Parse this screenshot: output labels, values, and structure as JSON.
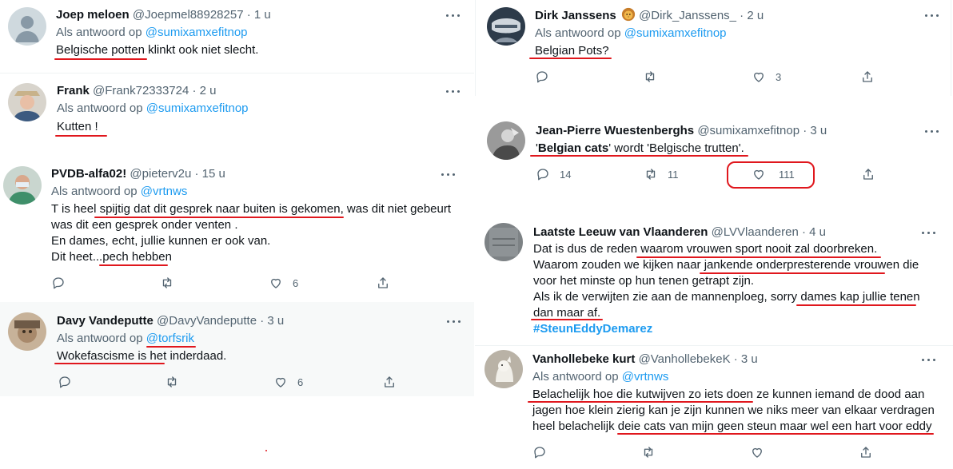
{
  "left": [
    {
      "name": "Joep meloen",
      "meta": "@Joepmel88928257 · 1 u",
      "reply_prefix": "Als antwoord op",
      "reply_to": "@sumixamxefitnop",
      "lines": [
        "Belgische potten klinkt ook niet slecht."
      ]
    },
    {
      "name": "Frank",
      "meta": "@Frank72333724 · 2 u",
      "reply_prefix": "Als antwoord op",
      "reply_to": "@sumixamxefitnop",
      "lines": [
        "Kutten !"
      ]
    },
    {
      "name": "PVDB-alfa02!",
      "meta": "@pieterv2u · 15 u",
      "reply_prefix": "Als antwoord op",
      "reply_to": "@vrtnws",
      "lines": [
        "T is heel spijtig dat dit gesprek naar buiten is gekomen, was dit niet gebeurt",
        "was dit een gesprek onder venten .",
        "En dames, echt, jullie kunnen er ook van.",
        "Dit heet...pech hebben"
      ],
      "likes": "6"
    },
    {
      "name": "Davy Vandeputte",
      "meta": "@DavyVandeputte · 3 u",
      "reply_prefix": "Als antwoord op",
      "reply_to": "@torfsrik",
      "lines": [
        "Wokefascisme is het inderdaad."
      ],
      "likes": "6"
    }
  ],
  "right": [
    {
      "name": "Dirk Janssens",
      "badge": "lion-emoji",
      "meta": "@Dirk_Janssens_ · 2 u",
      "reply_prefix": "Als antwoord op",
      "reply_to": "@sumixamxefitnop",
      "lines": [
        "Belgian Pots?"
      ],
      "likes": "3"
    },
    {
      "name": "Jean-Pierre Wuestenberghs",
      "meta": "@sumixamxefitnop · 3 u",
      "segments": [
        "'",
        "Belgian cats",
        "' wordt 'Belgische trutten'."
      ],
      "replies": "14",
      "retweets": "11",
      "likes": "111"
    },
    {
      "name": "Laatste Leeuw van Vlaanderen",
      "meta": "@LVVlaanderen · 4 u",
      "lines": [
        "Dat is dus de reden waarom vrouwen sport nooit zal doorbreken.",
        "Waarom zouden we kijken naar jankende onderpresterende vrouwen die",
        "voor het minste op hun tenen getrapt zijn.",
        "Als ik de verwijten zie aan de mannenploeg, sorry dames kap jullie tenen",
        "dan maar af."
      ],
      "hashtag": "#SteunEddyDemarez"
    },
    {
      "name": "Vanhollebeke kurt",
      "meta": "@VanhollebekeK · 3 u",
      "reply_prefix": "Als antwoord op",
      "reply_to": "@vrtnws",
      "lines": [
        "Belachelijk hoe die kutwijven zo iets doen ze kunnen iemand de dood aan",
        "jagen hoe klein zierig kan je zijn kunnen we niks meer van elkaar verdragen",
        "heel belachelijk  deie cats van mijn geen steun maar wel een hart voor eddy"
      ]
    }
  ],
  "colors": {
    "accent": "#1d9bf0",
    "annotation": "#e0171d",
    "muted": "#536471"
  }
}
